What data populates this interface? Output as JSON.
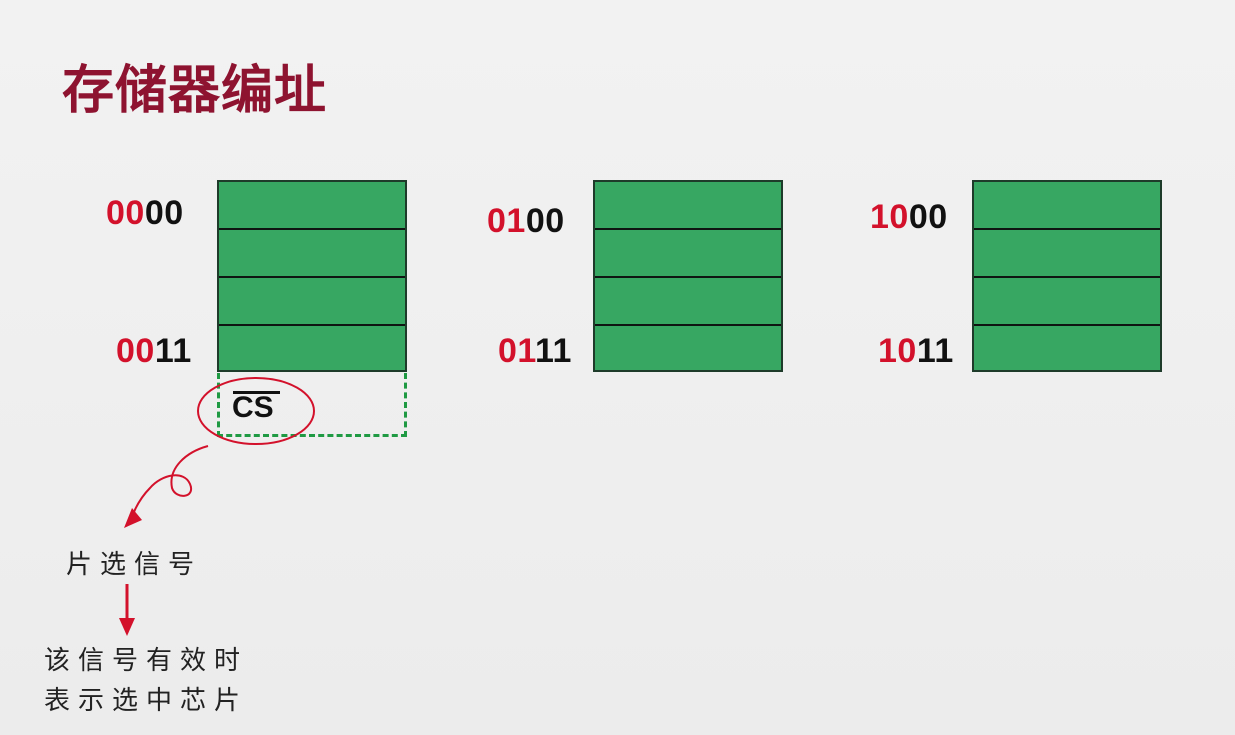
{
  "title": "存储器编址",
  "chips": [
    {
      "start": {
        "hi": "00",
        "lo": "00"
      },
      "end": {
        "hi": "00",
        "lo": "11"
      }
    },
    {
      "start": {
        "hi": "01",
        "lo": "00"
      },
      "end": {
        "hi": "01",
        "lo": "11"
      }
    },
    {
      "start": {
        "hi": "10",
        "lo": "00"
      },
      "end": {
        "hi": "10",
        "lo": "11"
      }
    }
  ],
  "cs_label": "CS",
  "notes": {
    "chip_select": "片选信号",
    "line1": "该信号有效时",
    "line2": "表示选中芯片"
  },
  "colors": {
    "title": "#8e1330",
    "chip_fill": "#37a762",
    "address_high_bits": "#d3112b",
    "address_low_bits": "#111111",
    "dashed_box": "#1f9a43",
    "annotation": "#d3112b"
  }
}
